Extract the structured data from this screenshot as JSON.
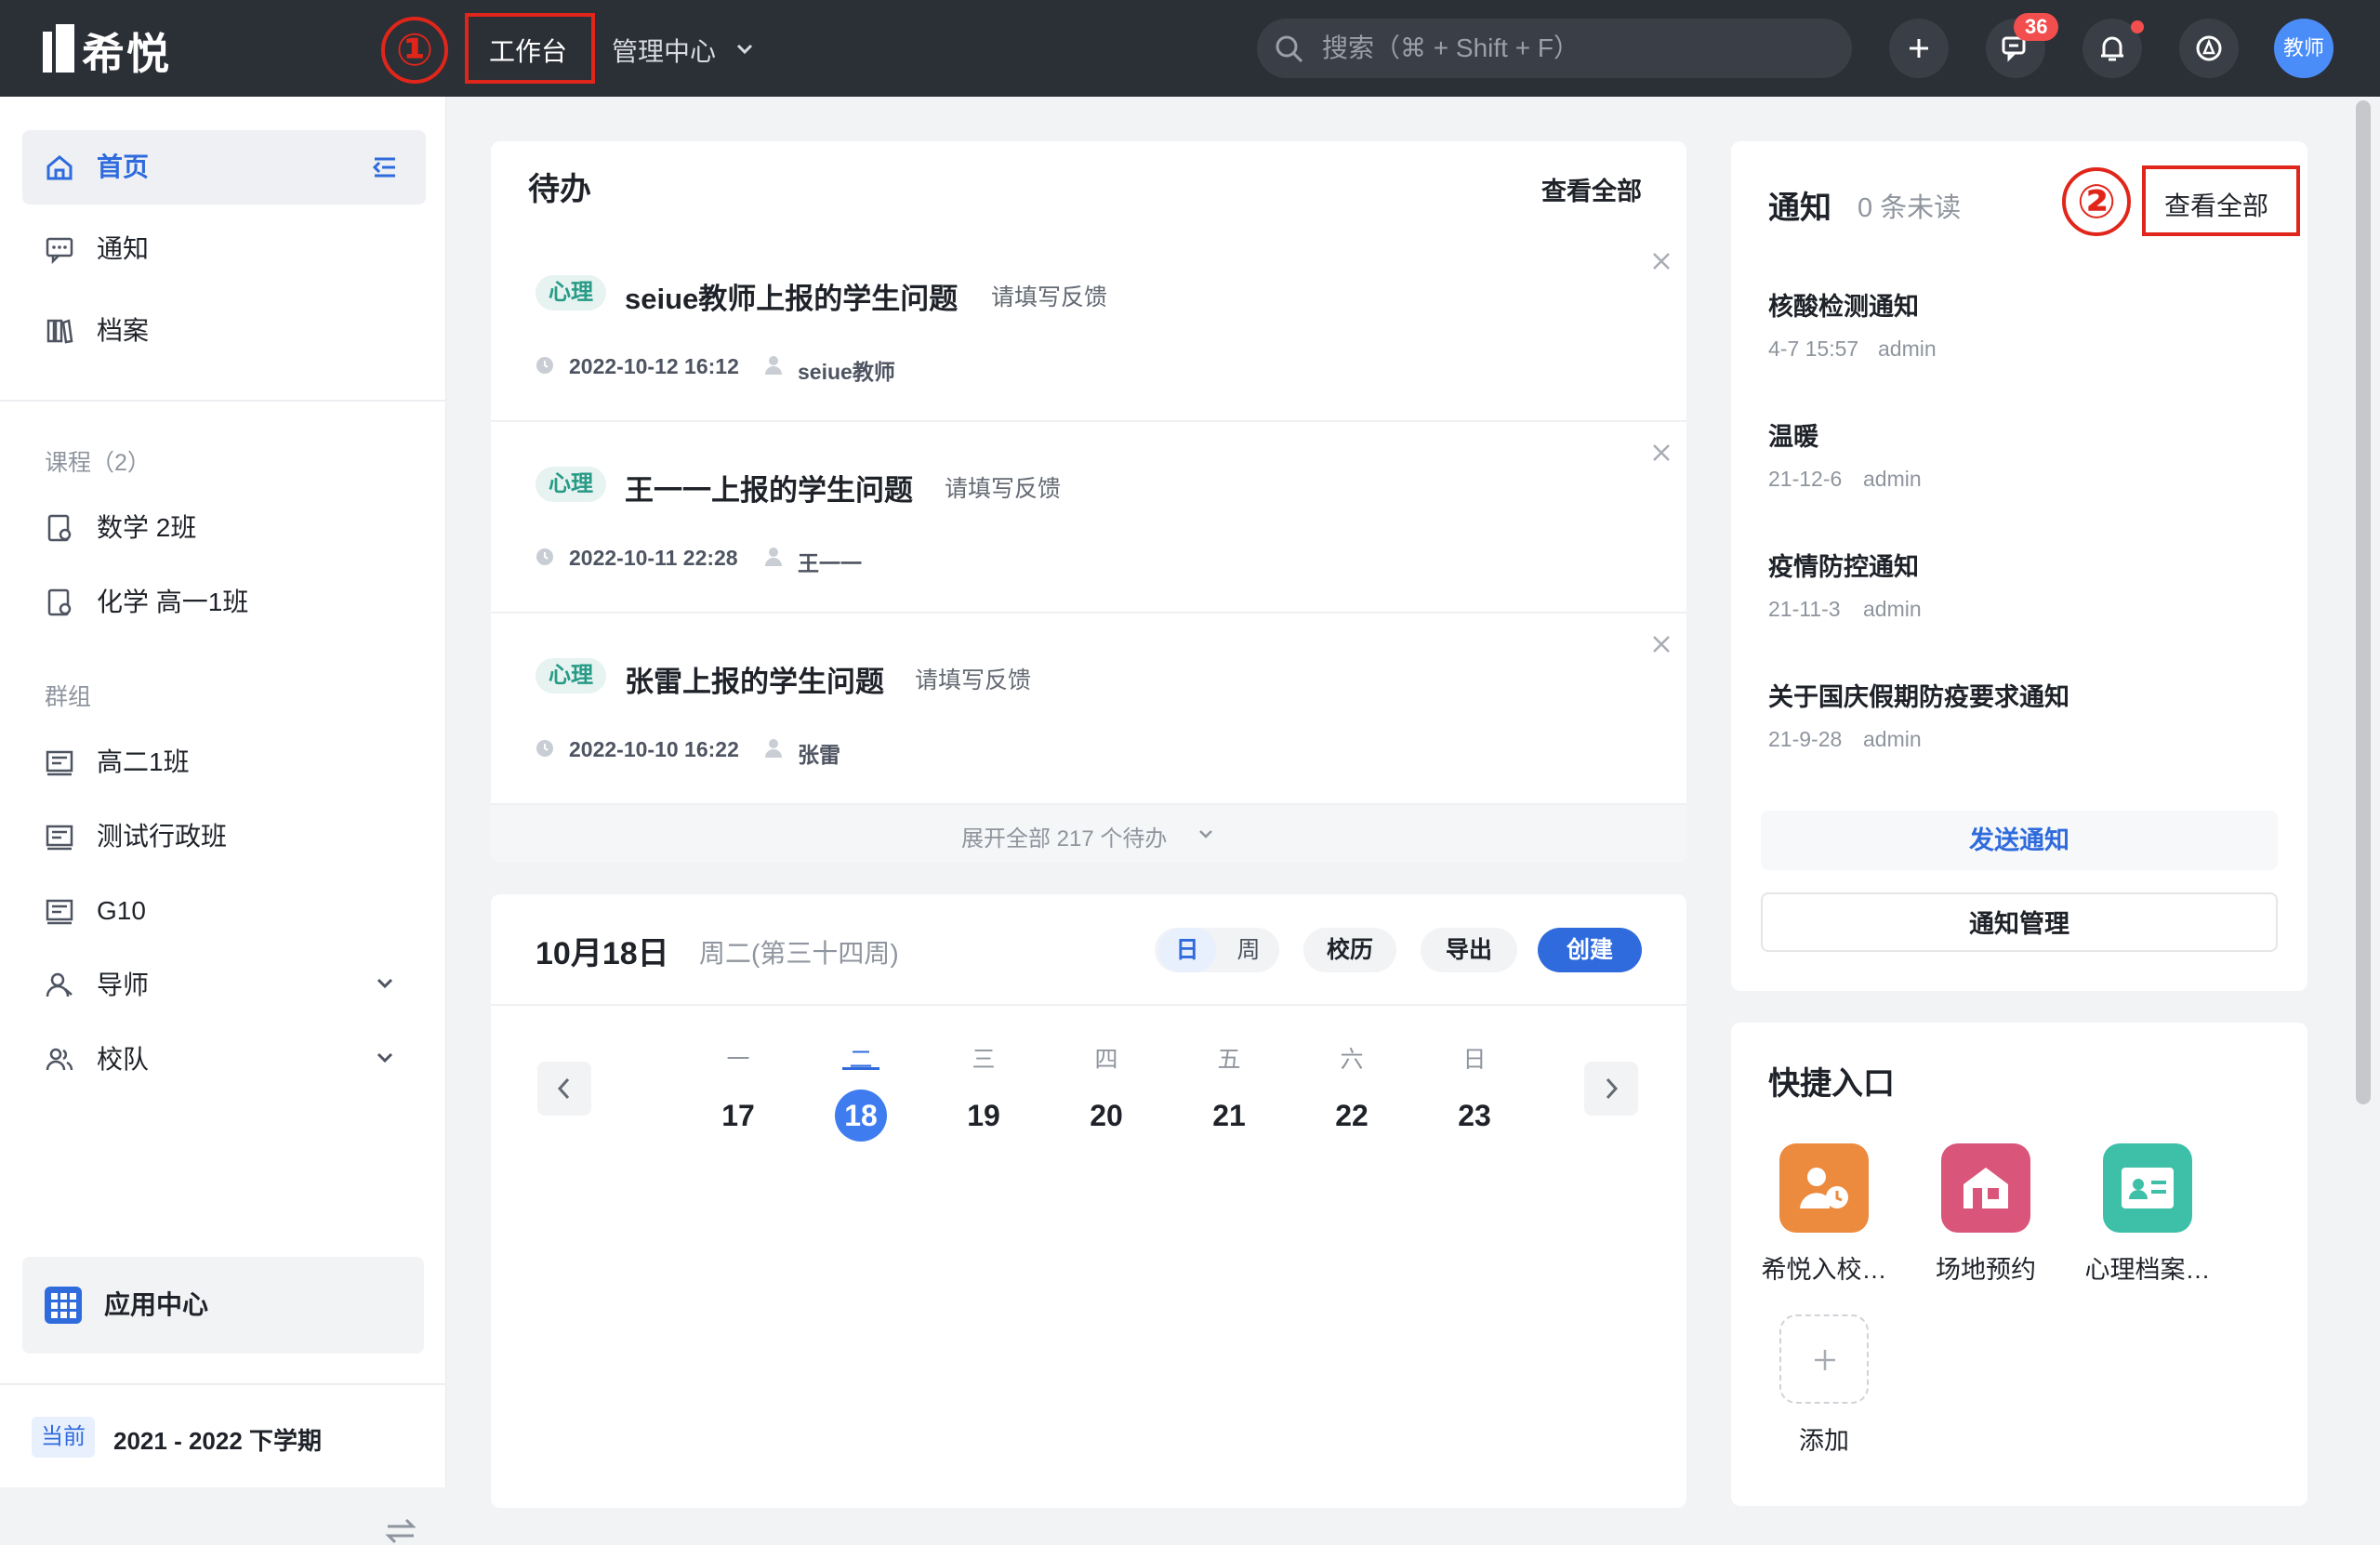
{
  "app": {
    "logo_text": "希悦"
  },
  "annotations": {
    "one": "①",
    "two": "②"
  },
  "header": {
    "tabs": [
      {
        "label": "工作台"
      },
      {
        "label": "管理中心"
      }
    ],
    "search_placeholder": "搜索（⌘ + Shift + F）",
    "messages_badge": "36",
    "avatar_label": "教师"
  },
  "sidebar": {
    "nav": [
      {
        "label": "首页"
      },
      {
        "label": "通知"
      },
      {
        "label": "档案"
      }
    ],
    "courses_header": "课程（2）",
    "courses": [
      {
        "label": "数学 2班"
      },
      {
        "label": "化学 高一1班"
      }
    ],
    "groups_header": "群组",
    "groups": [
      {
        "label": "高二1班"
      },
      {
        "label": "测试行政班"
      },
      {
        "label": "G10"
      },
      {
        "label": "导师"
      },
      {
        "label": "校队"
      }
    ],
    "app_center": "应用中心",
    "term_tag": "当前",
    "term": "2021 - 2022 下学期"
  },
  "todo": {
    "title": "待办",
    "view_all": "查看全部",
    "items": [
      {
        "tag": "心理",
        "title": "seiue教师上报的学生问题",
        "action": "请填写反馈",
        "time": "2022-10-12 16:12",
        "user": "seiue教师"
      },
      {
        "tag": "心理",
        "title": "王一一上报的学生问题",
        "action": "请填写反馈",
        "time": "2022-10-11 22:28",
        "user": "王一一"
      },
      {
        "tag": "心理",
        "title": "张雷上报的学生问题",
        "action": "请填写反馈",
        "time": "2022-10-10 16:22",
        "user": "张雷"
      }
    ],
    "expand": "展开全部 217 个待办"
  },
  "calendar": {
    "date": "10月18日",
    "weekday": "周二(第三十四周)",
    "view_day": "日",
    "view_week": "周",
    "school_cal": "校历",
    "export": "导出",
    "create": "创建",
    "days": [
      {
        "label": "一",
        "num": "17"
      },
      {
        "label": "二",
        "num": "18"
      },
      {
        "label": "三",
        "num": "19"
      },
      {
        "label": "四",
        "num": "20"
      },
      {
        "label": "五",
        "num": "21"
      },
      {
        "label": "六",
        "num": "22"
      },
      {
        "label": "日",
        "num": "23"
      }
    ]
  },
  "notices": {
    "title": "通知",
    "unread": "0 条未读",
    "view_all": "查看全部",
    "items": [
      {
        "title": "核酸检测通知",
        "date": "4-7 15:57",
        "author": "admin"
      },
      {
        "title": "温暖",
        "date": "21-12-6",
        "author": "admin"
      },
      {
        "title": "疫情防控通知",
        "date": "21-11-3",
        "author": "admin"
      },
      {
        "title": "关于国庆假期防疫要求通知",
        "date": "21-9-28",
        "author": "admin"
      }
    ],
    "send": "发送通知",
    "manage": "通知管理"
  },
  "quick": {
    "title": "快捷入口",
    "items": [
      {
        "label": "希悦入校…",
        "color": "#ec8a3e"
      },
      {
        "label": "场地预约",
        "color": "#d9557a"
      },
      {
        "label": "心理档案…",
        "color": "#3dbfa8"
      }
    ],
    "add": "添加"
  },
  "colors": {
    "accent": "#2f6bdc",
    "topbar": "#2b2f36",
    "annotation": "#e0261b"
  }
}
